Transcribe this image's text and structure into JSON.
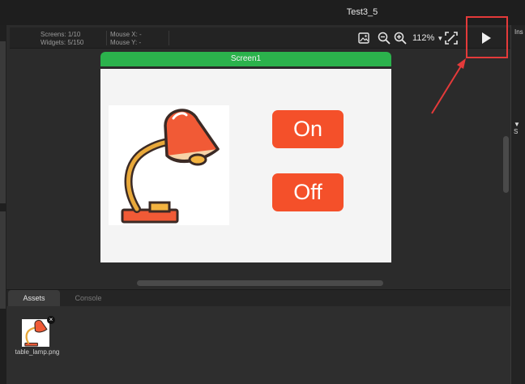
{
  "window": {
    "title": "Test3_5"
  },
  "toolbar": {
    "screens_label": "Screens:",
    "screens_value": "1/10",
    "widgets_label": "Widgets:",
    "widgets_value": "5/150",
    "mouse_x_label": "Mouse X:",
    "mouse_x_value": "-",
    "mouse_y_label": "Mouse Y:",
    "mouse_y_value": "-",
    "zoom_label": "112%",
    "icons": [
      "image-icon",
      "zoom-out-icon",
      "zoom-in-icon",
      "fullscreen-icon",
      "play-icon"
    ]
  },
  "screen": {
    "name": "Screen1",
    "header_color": "#2bb24c",
    "background": "#f4f4f4",
    "on_label": "On",
    "off_label": "Off",
    "button_color": "#f4502a"
  },
  "right_panel": {
    "tab_fragment": "Ins",
    "section_fragment": "S"
  },
  "bottom_panel": {
    "tabs": [
      "Assets",
      "Console"
    ],
    "assets": [
      {
        "filename": "table_lamp.png"
      }
    ]
  },
  "annotation": {
    "highlight_color": "#e43a3a"
  }
}
